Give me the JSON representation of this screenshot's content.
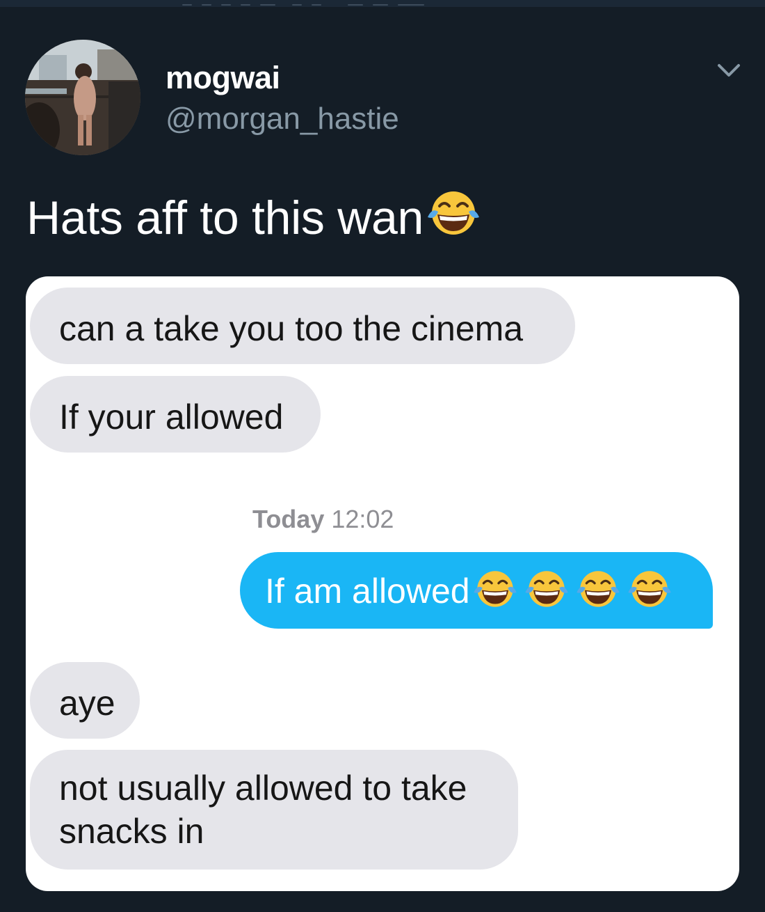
{
  "tweet": {
    "display_name": "mogwai",
    "handle": "@morgan_hastie",
    "text": "Hats aff to this wan",
    "text_emoji": "face-with-tears-of-joy",
    "menu_icon": "chevron-down-icon",
    "avatar_icon": "profile-photo"
  },
  "screenshot": {
    "messages": [
      {
        "side": "received",
        "text": "can a take you too the cinema"
      },
      {
        "side": "received",
        "text": "If your allowed"
      },
      {
        "side": "sent",
        "text": "If am allowed",
        "emoji": "face-with-tears-of-joy",
        "emoji_count": 4
      },
      {
        "side": "received",
        "text": "aye"
      },
      {
        "side": "received",
        "text": "not usually allowed to take snacks in"
      }
    ],
    "timestamp": {
      "day": "Today",
      "time": "12:02"
    }
  },
  "colors": {
    "background": "#141d26",
    "handle": "#8899a6",
    "sent_bubble": "#1ab6f5",
    "received_bubble": "#e5e5ea",
    "timestamp": "#8e8e93"
  }
}
